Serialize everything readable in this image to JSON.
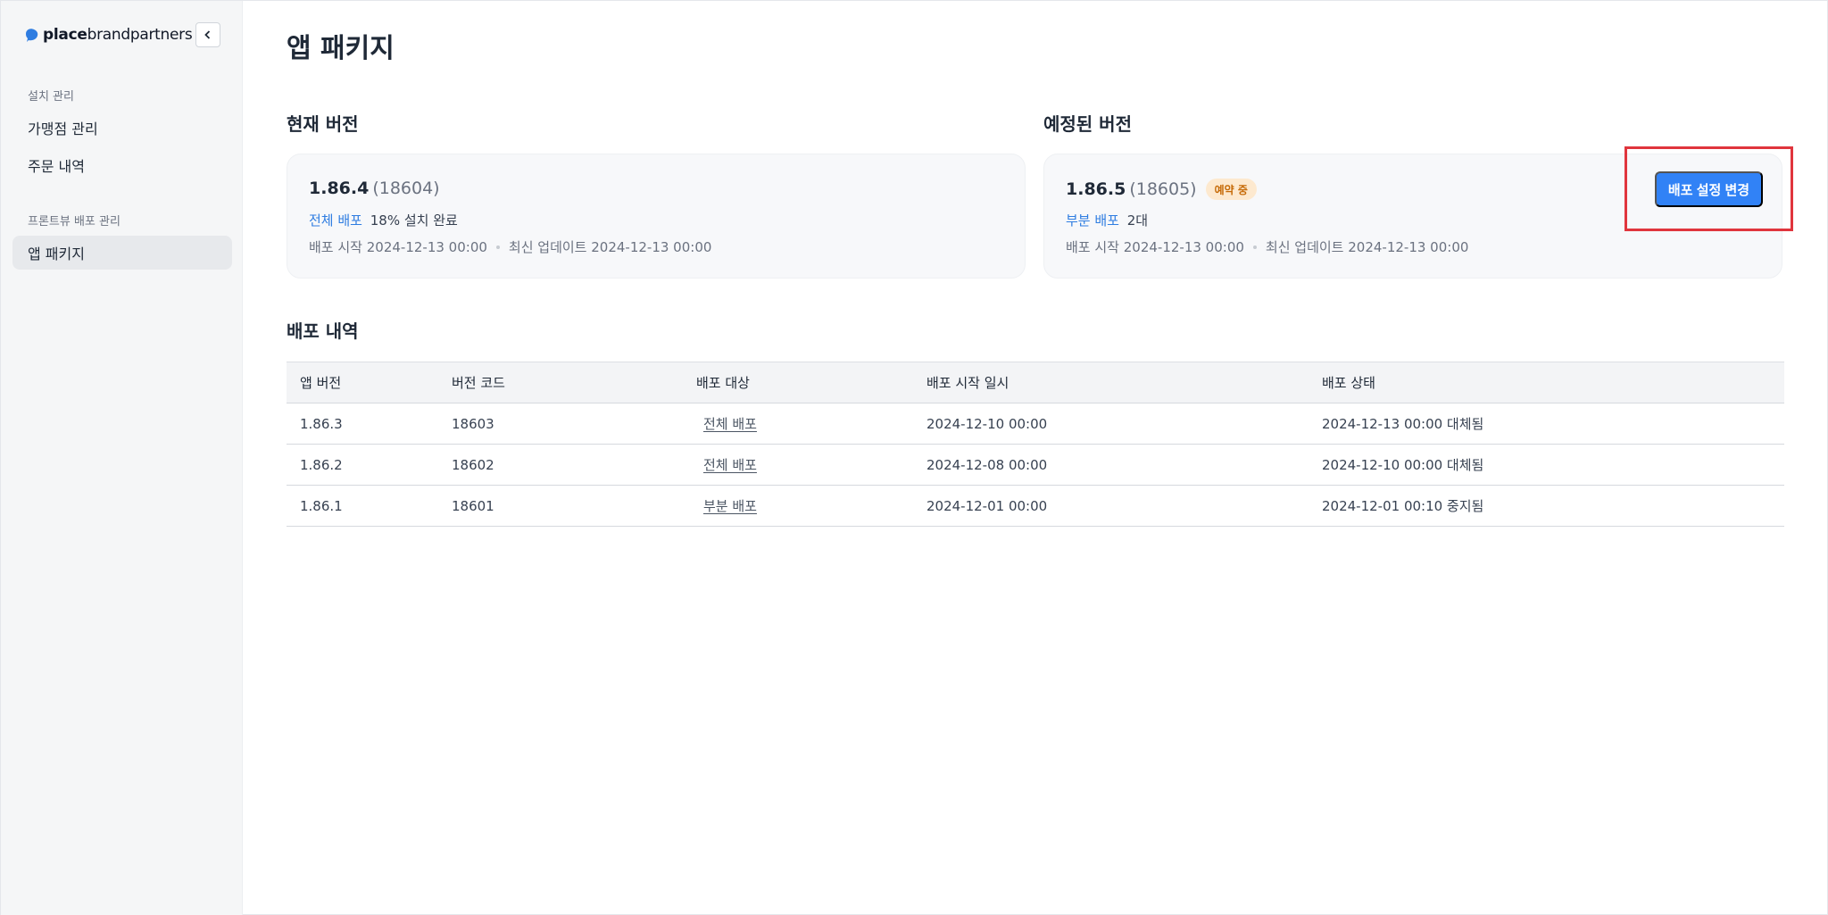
{
  "brand": {
    "name_bold": "place",
    "name_rest": "brandpartners"
  },
  "sidebar": {
    "sections": [
      {
        "title": "설치 관리",
        "items": [
          {
            "label": "가맹점 관리"
          },
          {
            "label": "주문 내역"
          }
        ]
      },
      {
        "title": "프론트뷰 배포 관리",
        "items": [
          {
            "label": "앱 패키지",
            "active": true
          }
        ]
      }
    ]
  },
  "page": {
    "title": "앱 패키지"
  },
  "current": {
    "section_title": "현재 버전",
    "version": "1.86.4",
    "code": "(18604)",
    "dist_type": "전체 배포",
    "dist_desc": "18% 설치 완료",
    "start": "배포 시작 2024-12-13 00:00",
    "updated": "최신 업데이트 2024-12-13 00:00"
  },
  "scheduled": {
    "section_title": "예정된 버전",
    "version": "1.86.5",
    "code": "(18605)",
    "badge": "예약 중",
    "dist_type": "부분 배포",
    "dist_desc": "2대",
    "start": "배포 시작 2024-12-13 00:00",
    "updated": "최신 업데이트 2024-12-13 00:00",
    "button": "배포 설정 변경"
  },
  "history": {
    "title": "배포 내역",
    "columns": [
      "앱 버전",
      "버전 코드",
      "배포 대상",
      "배포 시작 일시",
      "배포 상태"
    ],
    "rows": [
      [
        "1.86.3",
        "18603",
        "전체 배포",
        "2024-12-10 00:00",
        "2024-12-13 00:00 대체됨"
      ],
      [
        "1.86.2",
        "18602",
        "전체 배포",
        "2024-12-08 00:00",
        "2024-12-10 00:00 대체됨"
      ],
      [
        "1.86.1",
        "18601",
        "부분 배포",
        "2024-12-01 00:00",
        "2024-12-01 00:10 중지됨"
      ]
    ]
  },
  "colors": {
    "accent": "#3182f6",
    "link": "#2f7de1",
    "badge_bg": "#fde9cf",
    "badge_text": "#c66a07",
    "highlight": "#e0353d"
  }
}
